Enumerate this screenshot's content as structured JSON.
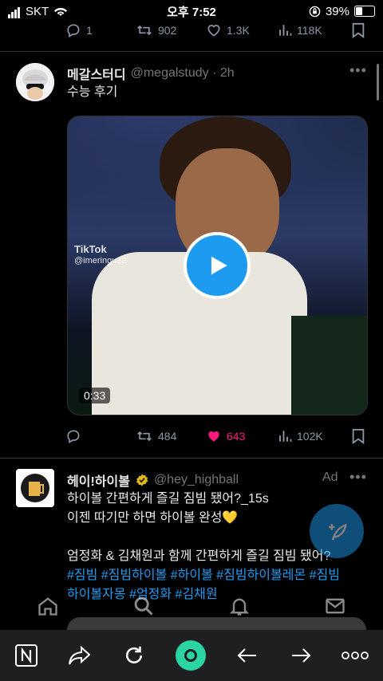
{
  "status_bar": {
    "carrier": "SKT",
    "time": "오후 7:52",
    "battery": "39%"
  },
  "prev_tweet": {
    "replies": "1",
    "retweets": "902",
    "likes": "1.3K",
    "views": "118K"
  },
  "tweet1": {
    "name": "메갈스터디",
    "handle": "@megalstudy · 2h",
    "text": "수능 후기",
    "video": {
      "watermark_brand": "TikTok",
      "watermark_user": "@imeringue2",
      "duration": "0:33"
    },
    "replies": "",
    "retweets": "484",
    "likes": "643",
    "views": "102K"
  },
  "tweet2": {
    "name": "헤이!하이볼",
    "handle": "@hey_highball",
    "ad_label": "Ad",
    "line1": "하이볼 간편하게 즐길 짐빔 됐어?_15s",
    "line2": "이젠 따기만 하면 하이볼 완성💛",
    "line3": "엄정화 & 김채원과 함께 간편하게 즐길 짐빔 됐어?",
    "hashtags_line1": "#짐빔 #짐빔하이볼 #하이볼 #짐빔하이볼레몬 #짐빔",
    "hashtags_line2": "하이볼자몽 #엄정화 #김채원"
  },
  "colors": {
    "accent": "#1d9bf0",
    "like": "#f91880",
    "muted": "#71767b"
  }
}
